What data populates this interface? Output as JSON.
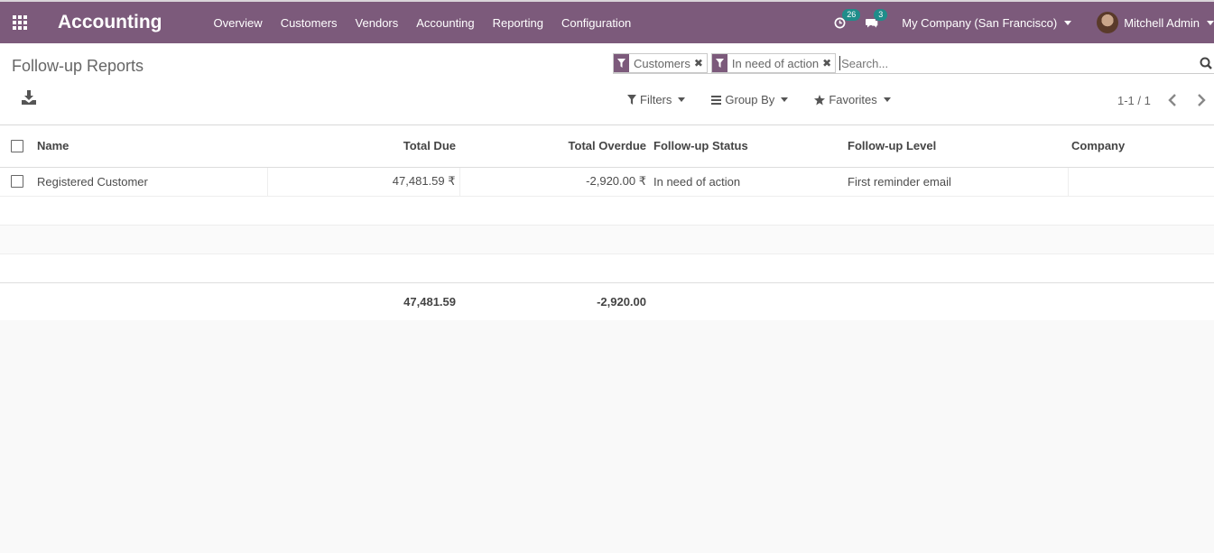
{
  "navbar": {
    "app_title": "Accounting",
    "menu": [
      "Overview",
      "Customers",
      "Vendors",
      "Accounting",
      "Reporting",
      "Configuration"
    ],
    "activity_count": "26",
    "messages_count": "3",
    "company": "My Company (San Francisco)",
    "user": "Mitchell Admin",
    "bg_color": "#7c5a7b",
    "badge_color": "#1f8d8a"
  },
  "control_panel": {
    "breadcrumb": "Follow-up Reports",
    "facets": [
      {
        "label": "Customers",
        "icon": "filter-icon"
      },
      {
        "label": "In need of action",
        "icon": "filter-icon"
      }
    ],
    "search_placeholder": "Search...",
    "filters_label": "Filters",
    "group_by_label": "Group By",
    "favorites_label": "Favorites",
    "pager": "1-1 / 1"
  },
  "table": {
    "headers": {
      "name": "Name",
      "total_due": "Total Due",
      "total_overdue": "Total Overdue",
      "status": "Follow-up Status",
      "level": "Follow-up Level",
      "company": "Company"
    },
    "rows": [
      {
        "name": "Registered Customer",
        "total_due": "47,481.59 ₹",
        "total_overdue": "-2,920.00 ₹",
        "status": "In need of action",
        "level": "First reminder email",
        "company": ""
      }
    ],
    "footer": {
      "total_due": "47,481.59",
      "total_overdue": "-2,920.00"
    }
  }
}
